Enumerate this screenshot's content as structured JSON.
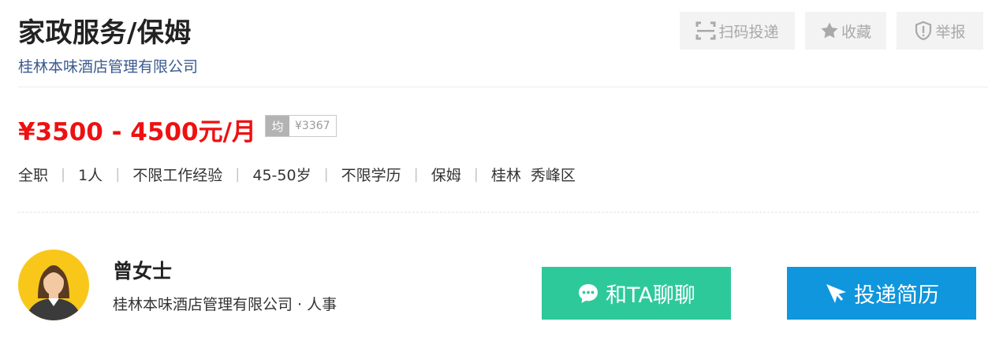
{
  "job": {
    "title": "家政服务/保姆",
    "company": "桂林本味酒店管理有限公司",
    "salary": "¥3500 - 4500元/月",
    "avg_tag": "均",
    "avg_value": "¥3367",
    "attributes": [
      "全职",
      "1人",
      "不限工作经验",
      "45-50岁",
      "不限学历",
      "保姆",
      "桂林  秀峰区"
    ]
  },
  "actions": {
    "scan_label": "扫码投递",
    "favorite_label": "收藏",
    "report_label": "举报"
  },
  "contact": {
    "name": "曾女士",
    "info": "桂林本味酒店管理有限公司 · 人事"
  },
  "buttons": {
    "chat_label": "和TA聊聊",
    "apply_label": "投递简历"
  },
  "icons": {
    "scan": "scan-icon",
    "favorite": "star-icon",
    "report": "shield-icon",
    "chat": "chat-bubble-icon",
    "apply": "paper-plane-icon"
  },
  "colors": {
    "salary": "#ee1111",
    "company_link": "#3a5a8f",
    "chat_button": "#2ec99a",
    "apply_button": "#0f96dc",
    "avatar_bg": "#f8c719"
  }
}
